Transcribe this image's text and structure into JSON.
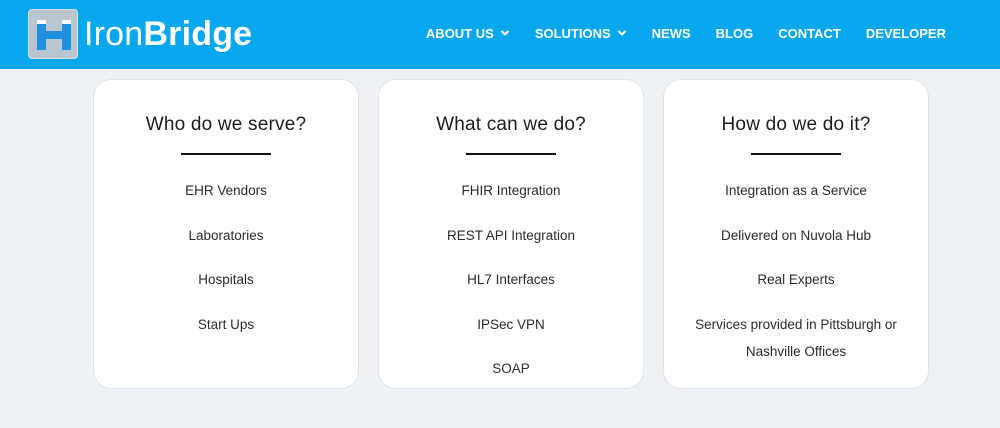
{
  "header": {
    "logo": {
      "icon": "ironbridge-h-logo-icon",
      "text_light": "Iron",
      "text_bold": "Bridge"
    },
    "nav": [
      {
        "label": "ABOUT US",
        "has_dropdown": true
      },
      {
        "label": "SOLUTIONS",
        "has_dropdown": true
      },
      {
        "label": "NEWS",
        "has_dropdown": false
      },
      {
        "label": "BLOG",
        "has_dropdown": false
      },
      {
        "label": "CONTACT",
        "has_dropdown": false
      },
      {
        "label": "DEVELOPER",
        "has_dropdown": false
      }
    ]
  },
  "cards": [
    {
      "title": "Who do we serve?",
      "items": [
        "EHR Vendors",
        "Laboratories",
        "Hospitals",
        "Start Ups"
      ]
    },
    {
      "title": "What can we do?",
      "items": [
        "FHIR Integration",
        "REST API Integration",
        "HL7 Interfaces",
        "IPSec VPN",
        "SOAP"
      ]
    },
    {
      "title": "How do we do it?",
      "items": [
        "Integration as a Service",
        "Delivered on Nuvola Hub",
        "Real Experts",
        "Services provided in Pittsburgh or Nashville Offices"
      ]
    }
  ],
  "colors": {
    "header_bg": "#07a7ee",
    "page_bg": "#eef2f7",
    "card_bg": "#ffffff",
    "logo_accent": "#1f8fe0"
  }
}
